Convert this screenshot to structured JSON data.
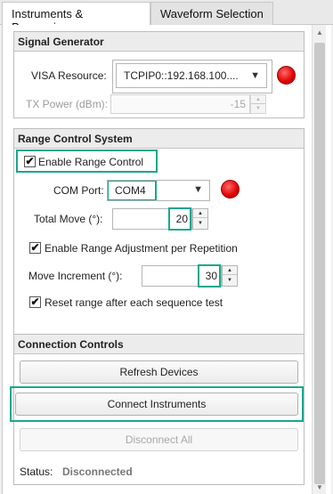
{
  "tabs": [
    {
      "label": "Instruments & Processing"
    },
    {
      "label": "Waveform Selection"
    }
  ],
  "signal_generator": {
    "title": "Signal Generator",
    "visa_label": "VISA Resource:",
    "visa_value": "TCPIP0::192.168.100....",
    "tx_power_label": "TX Power (dBm):",
    "tx_power_value": "-15"
  },
  "range_control": {
    "title": "Range Control System",
    "enable_label": "Enable Range Control",
    "com_port_label": "COM Port:",
    "com_port_value": "COM4",
    "total_move_label": "Total Move (°):",
    "total_move_value": "20",
    "adjust_label": "Enable Range Adjustment per Repetition",
    "move_increment_label": "Move Increment (°):",
    "move_increment_value": "30",
    "reset_label": "Reset range after each sequence test"
  },
  "connection": {
    "title": "Connection Controls",
    "refresh_label": "Refresh Devices",
    "connect_label": "Connect Instruments",
    "disconnect_label": "Disconnect All",
    "status_label": "Status:",
    "status_value": "Disconnected"
  },
  "icons": {
    "check": "✔",
    "caret": "▼",
    "spin_up": "▲",
    "spin_down": "▼"
  },
  "colors": {
    "highlight": "#1aa68e",
    "lamp_off": "#e00000"
  }
}
